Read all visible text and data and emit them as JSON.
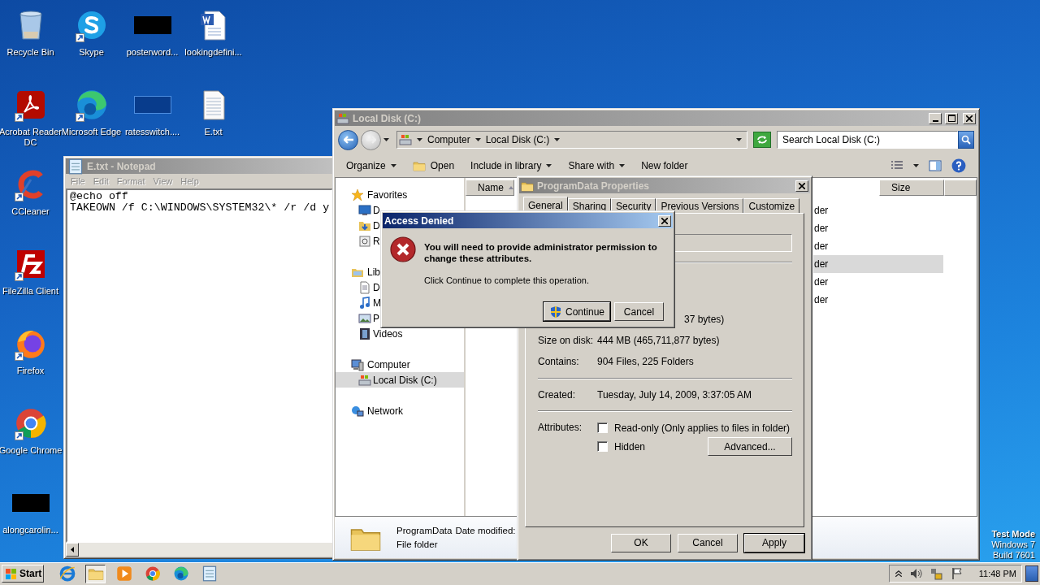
{
  "desktop": {
    "icons": [
      {
        "label": "Recycle Bin",
        "kind": "recycle",
        "shortcut": false
      },
      {
        "label": "Skype",
        "kind": "skype",
        "shortcut": true
      },
      {
        "label": "posterword...",
        "kind": "blank",
        "shortcut": false
      },
      {
        "label": "lookingdefini...",
        "kind": "word",
        "shortcut": false
      },
      {
        "label": "Acrobat Reader DC",
        "kind": "acrobat",
        "shortcut": true
      },
      {
        "label": "Microsoft Edge",
        "kind": "edge",
        "shortcut": true
      },
      {
        "label": "ratesswitch....",
        "kind": "bluefile",
        "shortcut": false
      },
      {
        "label": "E.txt",
        "kind": "text",
        "shortcut": false
      },
      {
        "label": "CCleaner",
        "kind": "ccleaner",
        "shortcut": true
      },
      {
        "label": "FileZilla Client",
        "kind": "filezilla",
        "shortcut": true
      },
      {
        "label": "Firefox",
        "kind": "firefox",
        "shortcut": true
      },
      {
        "label": "Google Chrome",
        "kind": "chrome",
        "shortcut": true
      },
      {
        "label": "alongcarolin...",
        "kind": "blank",
        "shortcut": false
      }
    ],
    "system_text": [
      "Test Mode",
      "Windows 7",
      "Build 7601"
    ]
  },
  "notepad": {
    "title": "E.txt - Notepad",
    "menu": [
      "File",
      "Edit",
      "Format",
      "View",
      "Help"
    ],
    "lines": [
      "@echo off",
      "TAKEOWN /f C:\\WINDOWS\\SYSTEM32\\* /r /d y"
    ]
  },
  "explorer": {
    "title": "Local Disk (C:)",
    "breadcrumb": [
      "Computer",
      "Local Disk (C:)"
    ],
    "search": {
      "placeholder": "Search Local Disk (C:)"
    },
    "toolbar": [
      {
        "label": "Organize",
        "kind": "menu"
      },
      {
        "label": "Open",
        "kind": "open"
      },
      {
        "label": "Include in library",
        "kind": "menu"
      },
      {
        "label": "Share with",
        "kind": "menu"
      },
      {
        "label": "New folder",
        "kind": "plain"
      }
    ],
    "nav": [
      {
        "label": "Favorites",
        "kind": "star",
        "selected": false,
        "children": [
          {
            "label": "D",
            "kind": "desktop",
            "selected": false
          },
          {
            "label": "D",
            "kind": "download",
            "selected": false
          },
          {
            "label": "R",
            "kind": "recent",
            "selected": false
          }
        ]
      },
      {
        "label": "Lib",
        "kind": "library",
        "selected": false,
        "children": [
          {
            "label": "D",
            "kind": "doc",
            "selected": false
          },
          {
            "label": "M",
            "kind": "music",
            "selected": false
          },
          {
            "label": "P",
            "kind": "picture",
            "selected": false
          },
          {
            "label": "Videos",
            "kind": "video",
            "selected": false
          }
        ]
      },
      {
        "label": "Computer",
        "kind": "computer",
        "selected": false,
        "children": [
          {
            "label": "Local Disk (C:)",
            "kind": "drive",
            "selected": true
          }
        ]
      },
      {
        "label": "Network",
        "kind": "network",
        "selected": false
      }
    ],
    "columns": [
      "Name",
      "Size"
    ],
    "rows": [
      {
        "type": "der",
        "selected": false
      },
      {
        "type": "der",
        "selected": false
      },
      {
        "type": "der",
        "selected": false
      },
      {
        "type": "der",
        "selected": true
      },
      {
        "type": "der",
        "selected": false
      },
      {
        "type": "der",
        "selected": false
      }
    ],
    "details": {
      "name": "ProgramData",
      "date_label": "Date modified:",
      "type": "File folder"
    }
  },
  "properties": {
    "title": "ProgramData Properties",
    "tabs": [
      {
        "label": "General",
        "selected": true
      },
      {
        "label": "Sharing",
        "selected": false
      },
      {
        "label": "Security",
        "selected": false
      },
      {
        "label": "Previous Versions",
        "selected": false
      },
      {
        "label": "Customize",
        "selected": false
      }
    ],
    "size_rows": [
      {
        "value": "37 bytes)"
      },
      {
        "label": "Size on disk:",
        "value": "444 MB (465,711,877 bytes)"
      },
      {
        "label": "Contains:",
        "value": "904 Files, 225 Folders"
      }
    ],
    "date_rows": [
      {
        "label": "Created:",
        "value": "Tuesday, July 14, 2009, 3:37:05 AM"
      }
    ],
    "attributes": {
      "label": "Attributes:",
      "options": [
        {
          "label": "Read-only (Only applies to files in folder)",
          "checked": false
        },
        {
          "label": "Hidden",
          "checked": false
        }
      ],
      "advanced": "Advanced..."
    },
    "buttons": [
      {
        "label": "OK",
        "default": false
      },
      {
        "label": "Cancel",
        "default": false
      },
      {
        "label": "Apply",
        "default": true
      }
    ]
  },
  "access_denied": {
    "title": "Access Denied",
    "message": "You will need to provide administrator permission to change these attributes.",
    "detail": "Click Continue to complete this operation.",
    "buttons": [
      {
        "label": "Continue",
        "kind": "shield",
        "default": true
      },
      {
        "label": "Cancel",
        "kind": "plain",
        "default": false
      }
    ]
  },
  "taskbar": {
    "start": "Start",
    "items": [
      {
        "kind": "ie",
        "selected": false
      },
      {
        "kind": "explorer",
        "selected": true
      },
      {
        "kind": "media",
        "selected": false
      },
      {
        "kind": "chrome",
        "selected": false
      },
      {
        "kind": "edge",
        "selected": false
      },
      {
        "kind": "notepad",
        "selected": false
      }
    ],
    "time": "11:48 PM"
  }
}
